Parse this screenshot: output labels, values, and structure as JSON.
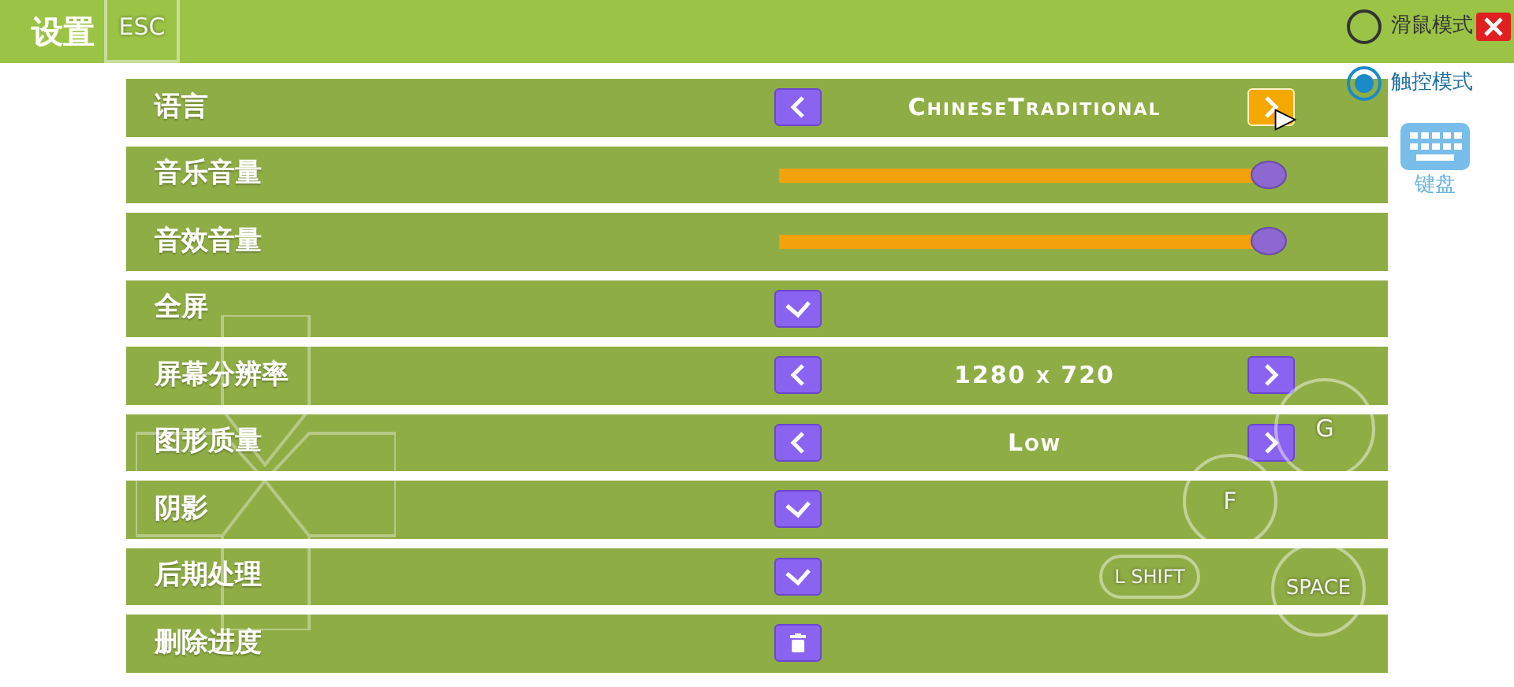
{
  "title": "设置",
  "settings": [
    {
      "kind": "choice",
      "label": "语言",
      "value": "ChineseTraditional",
      "next_highlighted": true
    },
    {
      "kind": "slider",
      "label": "音乐音量",
      "level": 0.98
    },
    {
      "kind": "slider",
      "label": "音效音量",
      "level": 0.98
    },
    {
      "kind": "toggle",
      "label": "全屏",
      "checked": true
    },
    {
      "kind": "choice",
      "label": "屏幕分辨率",
      "value": "1280 x 720",
      "next_highlighted": false
    },
    {
      "kind": "choice",
      "label": "图形质量",
      "value": "Low",
      "next_highlighted": false
    },
    {
      "kind": "toggle",
      "label": "阴影",
      "checked": true
    },
    {
      "kind": "toggle",
      "label": "后期处理",
      "checked": true
    },
    {
      "kind": "action",
      "label": "删除进度"
    }
  ],
  "modes": [
    {
      "label": "滑鼠模式",
      "selected": false
    },
    {
      "label": "触控模式",
      "selected": true
    }
  ],
  "keyboard_button": {
    "label": "键盘"
  },
  "touch_controls": [
    {
      "kind": "key",
      "label": "ESC"
    },
    {
      "kind": "dpad"
    },
    {
      "kind": "round",
      "label": "G"
    },
    {
      "kind": "round",
      "label": "F"
    },
    {
      "kind": "round",
      "label": "SPACE"
    },
    {
      "kind": "pill",
      "label": "L SHIFT"
    }
  ]
}
